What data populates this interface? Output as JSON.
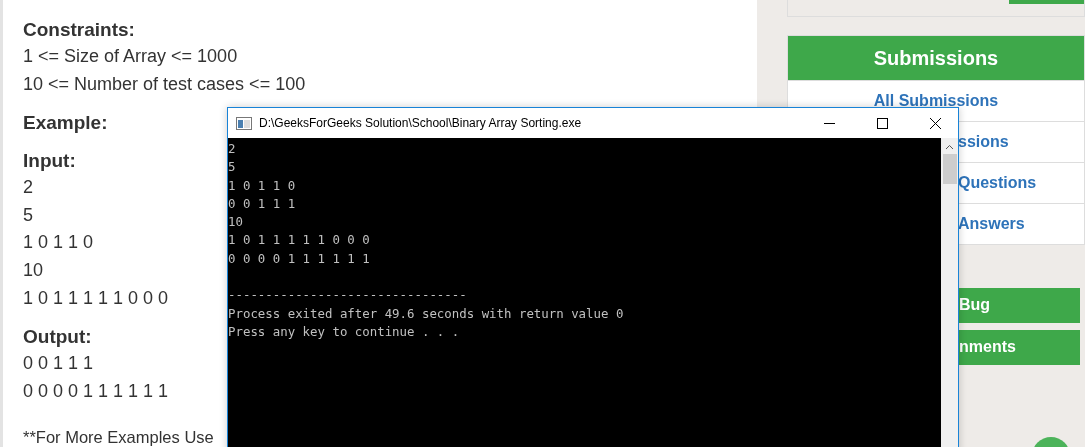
{
  "problem": {
    "sections": [
      {
        "heading": "Constraints:",
        "lines": [
          "1 <= Size of Array <= 1000",
          "10 <= Number of test cases <= 100"
        ]
      },
      {
        "heading": "Example:"
      },
      {
        "heading": "Input:",
        "lines": [
          "2",
          "5",
          "1 0 1 1 0",
          "10",
          "1 0 1 1 1 1 1 0 0 0"
        ]
      },
      {
        "heading": "Output:",
        "lines": [
          "0 0 1 1 1",
          "0 0 0 0 1 1 1 1 1 1"
        ]
      }
    ],
    "footnote": "**For More Examples Use"
  },
  "sidebar": {
    "header": "Submissions",
    "links": [
      {
        "label": "All Submissions",
        "cut": false
      },
      {
        "label": "ssions",
        "cut": true
      },
      {
        "label": "Questions",
        "cut": true
      },
      {
        "label": "Answers",
        "cut": true
      }
    ],
    "buttons": [
      "Bug",
      "nments"
    ]
  },
  "console": {
    "title": "D:\\GeeksForGeeks Solution\\School\\Binary Array Sorting.exe",
    "lines": [
      "2",
      "5",
      "1 0 1 1 0",
      "0 0 1 1 1",
      "10",
      "1 0 1 1 1 1 1 0 0 0",
      "0 0 0 0 1 1 1 1 1 1"
    ],
    "footer_lines": [
      "--------------------------------",
      "Process exited after 49.6 seconds with return value 0",
      "Press any key to continue . . ."
    ]
  }
}
